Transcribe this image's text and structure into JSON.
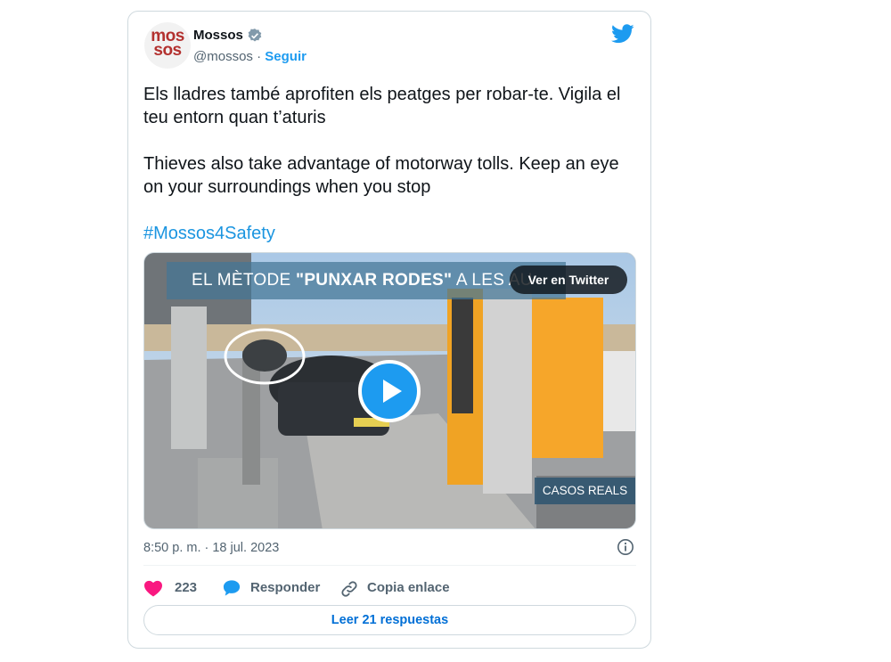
{
  "tweet": {
    "avatar_text_line1": "mos",
    "avatar_text_line2": "sos",
    "display_name": "Mossos",
    "handle": "@mossos",
    "separator": "·",
    "follow_label": "Seguir",
    "paragraph_ca": "Els lladres també aprofiten els peatges per robar-te. Vigila el teu entorn quan t’aturis",
    "paragraph_en": "Thieves also take advantage of motorway tolls. Keep an eye on your surroundings when you stop",
    "hashtag": "#Mossos4Safety",
    "timestamp": "8:50 p. m. · 18 jul. 2023"
  },
  "media": {
    "banner_prefix": "EL MÈTODE ",
    "banner_bold": "\"PUNXAR RODES\"",
    "banner_suffix": " A LES AU",
    "watch_label": "Ver en Twitter",
    "casos_label": "CASOS REALS"
  },
  "actions": {
    "like_count": "223",
    "reply_label": "Responder",
    "copy_label": "Copia enlace"
  },
  "footer": {
    "read_replies_label": "Leer 21 respuestas"
  },
  "colors": {
    "brand_blue": "#1d9bf0",
    "like_pink": "#f91880",
    "avatar_red": "#b3312f"
  },
  "icons": [
    "verified-badge-icon",
    "twitter-bird-icon",
    "play-icon",
    "info-icon",
    "heart-icon",
    "reply-bubble-icon",
    "link-icon"
  ]
}
